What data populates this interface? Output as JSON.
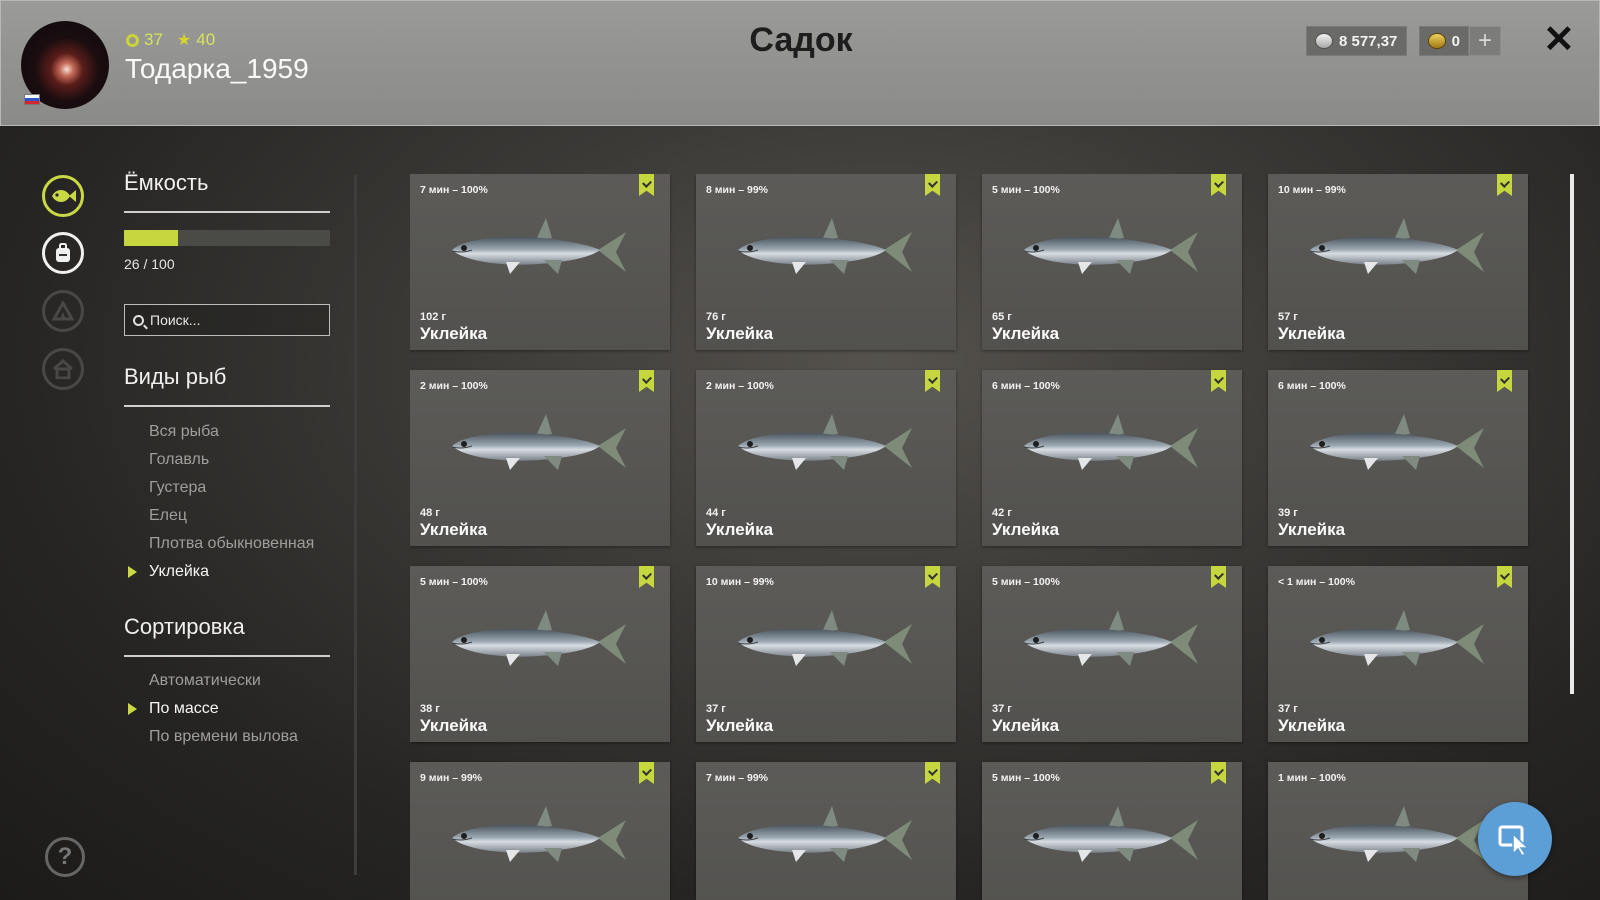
{
  "header": {
    "title": "Садок",
    "username": "Тодарка_1959",
    "level": "37",
    "rank": "40",
    "silver": "8 577,37",
    "gold": "0",
    "plus_label": "+",
    "close_label": "✕"
  },
  "capacity": {
    "label": "Ёмкость",
    "used": 26,
    "total": 100,
    "fill_fraction": 0.26,
    "text": "26 / 100"
  },
  "search": {
    "placeholder": "Поиск..."
  },
  "species": {
    "label": "Виды рыб",
    "items": [
      {
        "label": "Вся рыба",
        "active": false
      },
      {
        "label": "Голавль",
        "active": false
      },
      {
        "label": "Густера",
        "active": false
      },
      {
        "label": "Елец",
        "active": false
      },
      {
        "label": "Плотва обыкновенная",
        "active": false
      },
      {
        "label": "Уклейка",
        "active": true
      }
    ]
  },
  "sort": {
    "label": "Сортировка",
    "items": [
      {
        "label": "Автоматически",
        "active": false
      },
      {
        "label": "По массе",
        "active": true
      },
      {
        "label": "По времени вылова",
        "active": false
      }
    ]
  },
  "rail": {
    "icons": [
      "fish-icon",
      "backpack-icon",
      "tent-icon",
      "house-icon"
    ],
    "help_label": "?"
  },
  "colors": {
    "accent": "#c5d63f",
    "cursor_button": "#5b9fd6"
  },
  "catches": [
    {
      "time": "7 мин – 100%",
      "weight": "102 г",
      "name": "Уклейка",
      "bookmarked": true
    },
    {
      "time": "8 мин – 99%",
      "weight": "76 г",
      "name": "Уклейка",
      "bookmarked": true
    },
    {
      "time": "5 мин – 100%",
      "weight": "65 г",
      "name": "Уклейка",
      "bookmarked": true
    },
    {
      "time": "10 мин – 99%",
      "weight": "57 г",
      "name": "Уклейка",
      "bookmarked": true
    },
    {
      "time": "2 мин – 100%",
      "weight": "48 г",
      "name": "Уклейка",
      "bookmarked": true
    },
    {
      "time": "2 мин – 100%",
      "weight": "44 г",
      "name": "Уклейка",
      "bookmarked": true
    },
    {
      "time": "6 мин – 100%",
      "weight": "42 г",
      "name": "Уклейка",
      "bookmarked": true
    },
    {
      "time": "6 мин – 100%",
      "weight": "39 г",
      "name": "Уклейка",
      "bookmarked": true
    },
    {
      "time": "5 мин – 100%",
      "weight": "38 г",
      "name": "Уклейка",
      "bookmarked": true
    },
    {
      "time": "10 мин – 99%",
      "weight": "37 г",
      "name": "Уклейка",
      "bookmarked": true
    },
    {
      "time": "5 мин – 100%",
      "weight": "37 г",
      "name": "Уклейка",
      "bookmarked": true
    },
    {
      "time": "< 1 мин – 100%",
      "weight": "37 г",
      "name": "Уклейка",
      "bookmarked": true
    },
    {
      "time": "9 мин – 99%",
      "weight": "",
      "name": "",
      "bookmarked": true
    },
    {
      "time": "7 мин – 99%",
      "weight": "",
      "name": "",
      "bookmarked": true
    },
    {
      "time": "5 мин – 100%",
      "weight": "",
      "name": "",
      "bookmarked": true
    },
    {
      "time": "1 мин – 100%",
      "weight": "",
      "name": "",
      "bookmarked": false
    }
  ]
}
